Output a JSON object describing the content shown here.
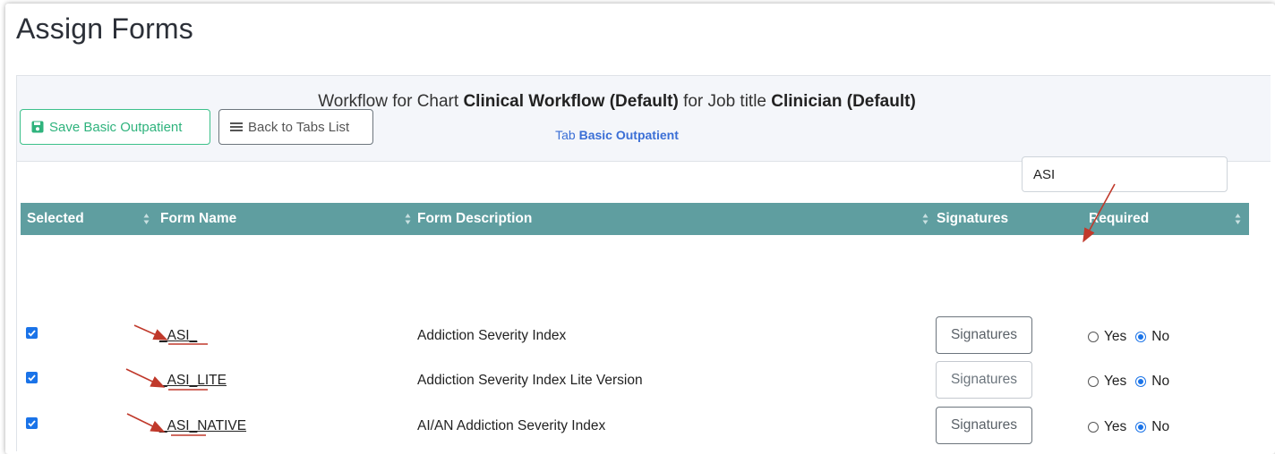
{
  "page": {
    "title": "Assign Forms"
  },
  "header": {
    "prefix": "Workflow for Chart",
    "chart_name": "Clinical Workflow (Default)",
    "middle": "for Job title",
    "job_title": "Clinician (Default)",
    "tab_prefix": "Tab",
    "tab_name": "Basic Outpatient"
  },
  "toolbar": {
    "save_label": "Save Basic Outpatient",
    "back_label": "Back to Tabs List"
  },
  "search": {
    "value": "ASI"
  },
  "table": {
    "columns": [
      "Selected",
      "Form Name",
      "Form Description",
      "Signatures",
      "Required"
    ],
    "rows": [
      {
        "selected": true,
        "name_prefix": "_ASI",
        "name_suffix": "_",
        "description": "Addiction Severity Index",
        "signatures": "Signatures",
        "yes": "Yes",
        "no": "No",
        "required": "No"
      },
      {
        "selected": true,
        "name_prefix": "_ASI",
        "name_suffix": "_LITE",
        "description": "Addiction Severity Index Lite Version",
        "signatures": "Signatures",
        "yes": "Yes",
        "no": "No",
        "required": "No"
      },
      {
        "selected": true,
        "name_prefix": "_ASI",
        "name_suffix": "_NATIVE",
        "description": "AI/AN Addiction Severity Index",
        "signatures": "Signatures",
        "yes": "Yes",
        "no": "No",
        "required": "No"
      }
    ]
  },
  "colors": {
    "table_header": "#5f9ea0",
    "save_green": "#3cc08a",
    "link_blue": "#3b6fd6",
    "annotation_red": "#c0392b"
  }
}
